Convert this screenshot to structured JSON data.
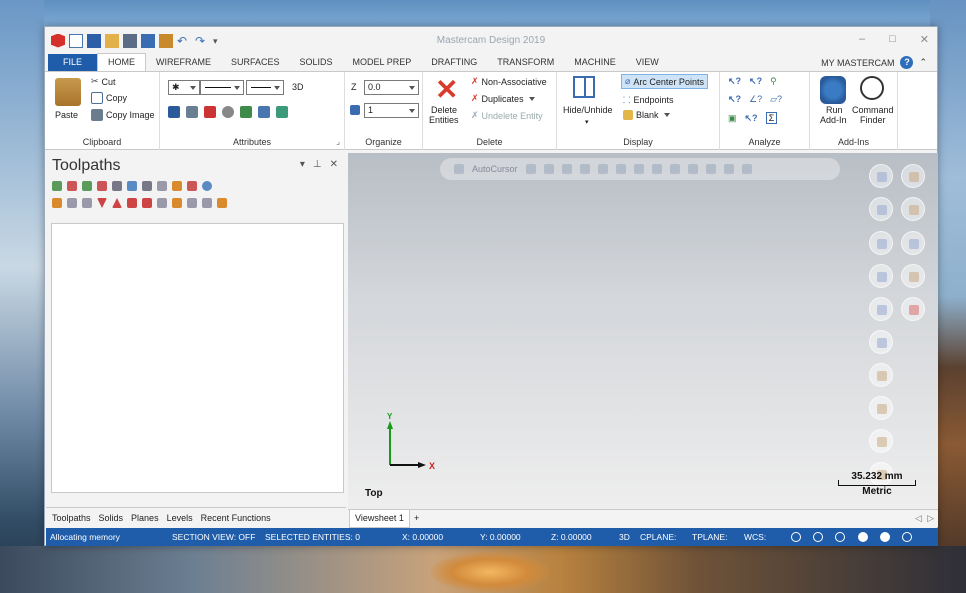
{
  "app": {
    "title": "Mastercam Design 2019",
    "window_controls": [
      "–",
      "□",
      "✕"
    ]
  },
  "tabs": {
    "file": "FILE",
    "items": [
      "HOME",
      "WIREFRAME",
      "SURFACES",
      "SOLIDS",
      "MODEL PREP",
      "DRAFTING",
      "TRANSFORM",
      "MACHINE",
      "VIEW"
    ],
    "active": "HOME",
    "account": "MY MASTERCAM",
    "help": "?"
  },
  "ribbon": {
    "clipboard": {
      "label": "Clipboard",
      "paste": "Paste",
      "cut": "Cut",
      "copy": "Copy",
      "copy_image": "Copy Image"
    },
    "attributes": {
      "label": "Attributes",
      "mode": "3D"
    },
    "organize": {
      "label": "Organize",
      "z_label": "Z",
      "z_value": "0.0",
      "level_value": "1"
    },
    "delete": {
      "label": "Delete",
      "delete_entities_1": "Delete",
      "delete_entities_2": "Entities",
      "non_associative": "Non-Associative",
      "duplicates": "Duplicates",
      "undelete": "Undelete Entity"
    },
    "display": {
      "label": "Display",
      "hide_unhide": "Hide/Unhide",
      "arc_center_points": "Arc Center Points",
      "endpoints": "Endpoints",
      "blank": "Blank"
    },
    "analyze": {
      "label": "Analyze"
    },
    "addins": {
      "label": "Add-Ins",
      "run_1": "Run",
      "run_2": "Add-In",
      "finder_1": "Command",
      "finder_2": "Finder"
    }
  },
  "panel": {
    "title": "Toolpaths",
    "tabs": [
      "Toolpaths",
      "Solids",
      "Planes",
      "Levels",
      "Recent Functions"
    ]
  },
  "viewport": {
    "autocursor": "AutoCursor",
    "view_name": "Top",
    "axis_x": "X",
    "axis_y": "Y",
    "scale_value": "35.232 mm",
    "scale_unit": "Metric",
    "viewsheet": "Viewsheet 1",
    "add_viewsheet": "+"
  },
  "status": {
    "message": "Allocating memory",
    "section_view": "SECTION VIEW: OFF",
    "selected": "SELECTED ENTITIES: 0",
    "x": "X:  0.00000",
    "y": "Y:  0.00000",
    "z": "Z:  0.00000",
    "mode": "3D",
    "cplane": "CPLANE:",
    "tplane": "TPLANE:",
    "wcs": "WCS:"
  },
  "colors": {
    "brand_blue": "#1f5dab",
    "delete_red": "#d93a2b",
    "highlight": "#cfe3f7"
  }
}
